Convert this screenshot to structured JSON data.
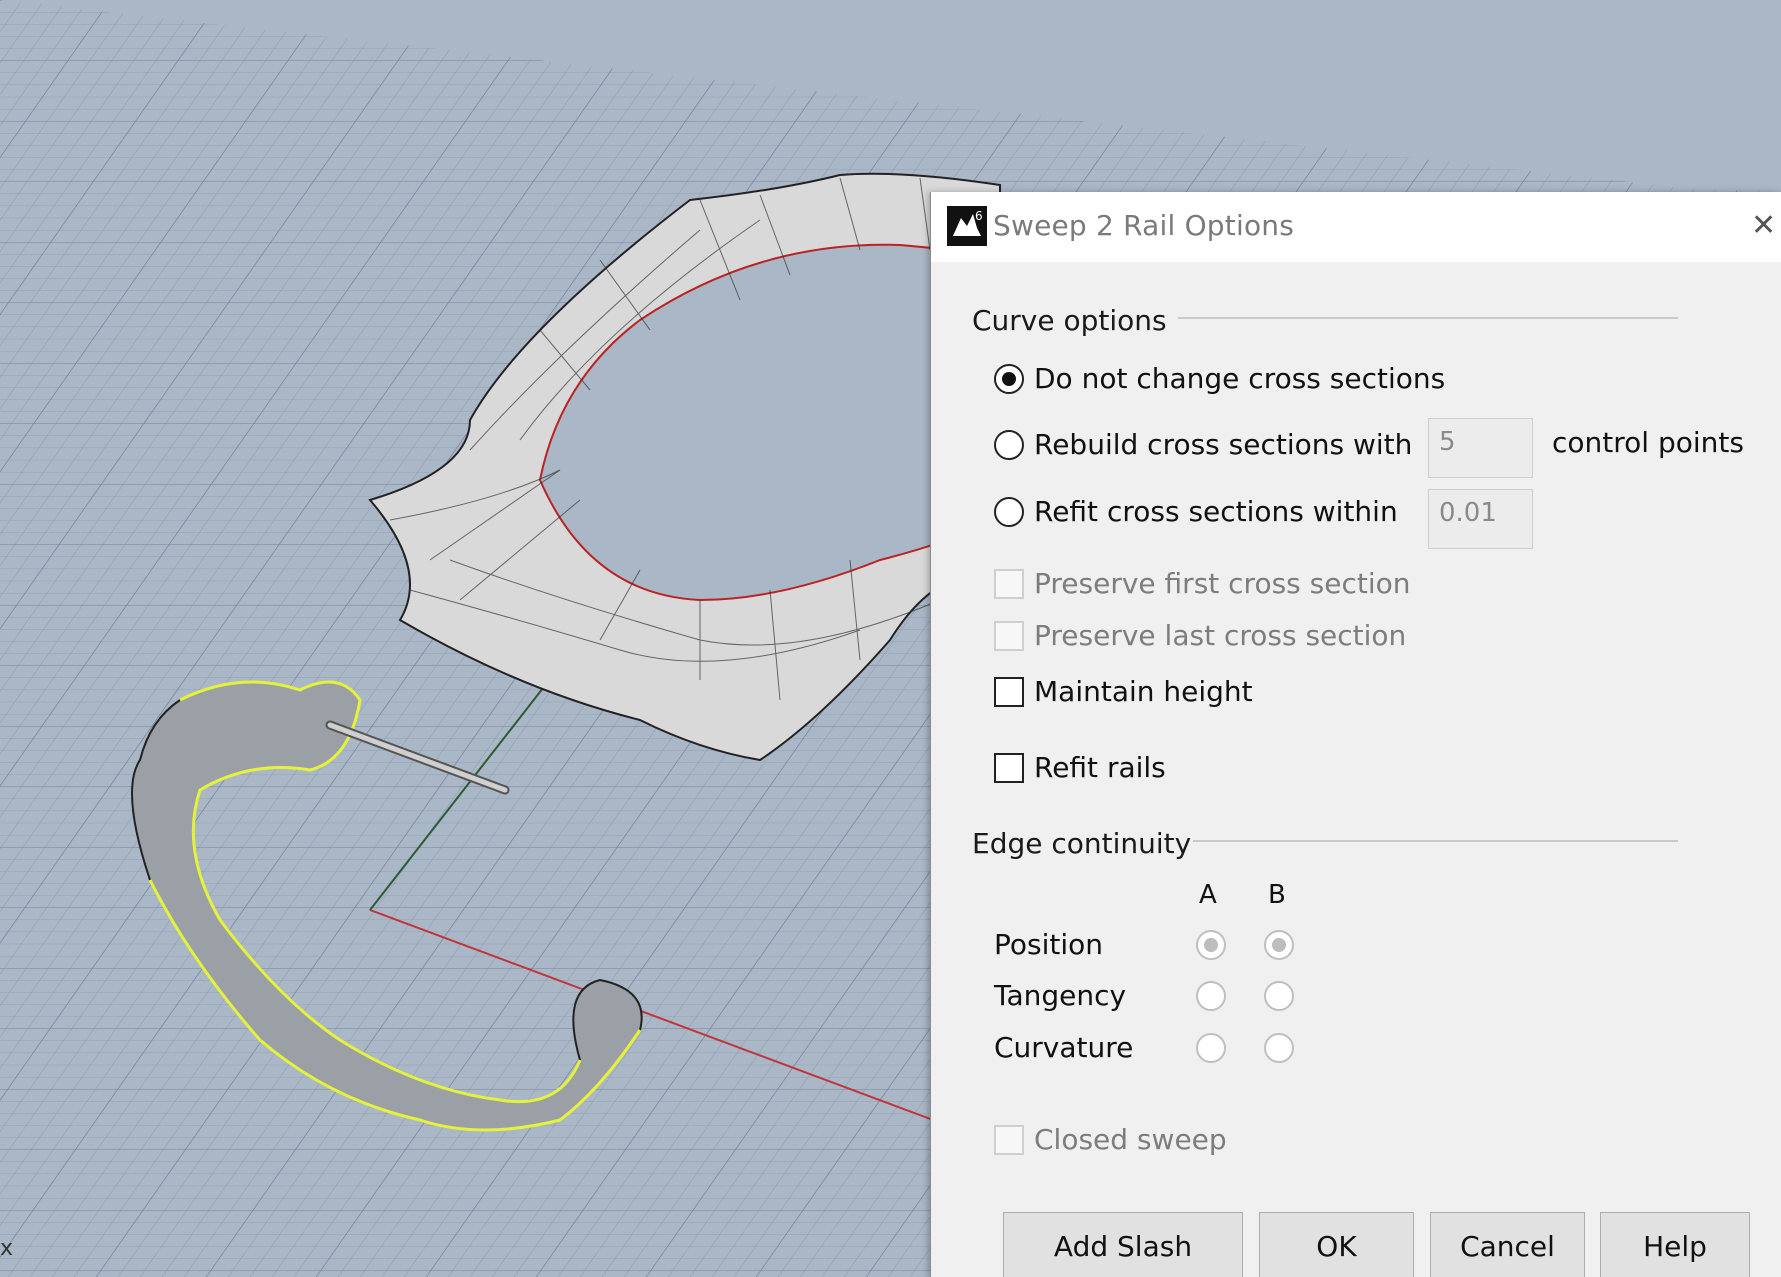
{
  "viewport": {
    "axis_label": "x",
    "colors": {
      "background": "#aab7c7",
      "grid": "#7f8fa3",
      "x_axis": "#c33",
      "y_axis": "#2f5f3a",
      "surface": "#d8d8d8",
      "selection": "#e5f23a"
    }
  },
  "dialog": {
    "title": "Sweep 2 Rail Options",
    "icon": "rhino-6-app-icon",
    "close_glyph": "✕",
    "curve_options": {
      "heading": "Curve options",
      "do_not_change": "Do not change cross sections",
      "rebuild": "Rebuild cross sections with",
      "rebuild_value": "5",
      "rebuild_suffix": "control points",
      "refit": "Refit cross sections within",
      "refit_value": "0.01",
      "preserve_first": "Preserve first cross section",
      "preserve_last": "Preserve last cross section",
      "maintain_height": "Maintain height",
      "refit_rails": "Refit rails",
      "selected": "do_not_change"
    },
    "edge_continuity": {
      "heading": "Edge continuity",
      "col_a": "A",
      "col_b": "B",
      "rows": [
        {
          "label": "Position",
          "a": true,
          "b": true
        },
        {
          "label": "Tangency",
          "a": false,
          "b": false
        },
        {
          "label": "Curvature",
          "a": false,
          "b": false
        }
      ]
    },
    "closed_sweep": "Closed sweep",
    "buttons": {
      "add_slash": "Add Slash",
      "ok": "OK",
      "cancel": "Cancel",
      "help": "Help"
    }
  }
}
